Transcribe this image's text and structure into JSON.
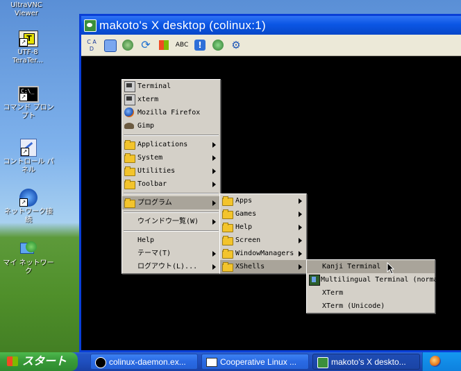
{
  "desktop": {
    "icons": [
      {
        "label": "UltraVNC Viewer",
        "icon": "ultravnc-icon"
      },
      {
        "label": "UTF-8 TeraTer...",
        "icon": "teraterm-icon"
      },
      {
        "label": "コマンド プロンプト",
        "icon": "command-prompt-icon"
      },
      {
        "label": "コントロール パネル",
        "icon": "control-panel-icon"
      },
      {
        "label": "ネットワーク接続",
        "icon": "network-connections-icon"
      },
      {
        "label": "マイ ネットワーク",
        "icon": "my-network-icon"
      }
    ]
  },
  "window": {
    "title": "makoto's X desktop (colinux:1)"
  },
  "toolbar": {
    "buttons": [
      "connection-options-icon",
      "fullscreen-icon",
      "refresh-icon",
      "swap-icon",
      "windows-key-icon",
      "text-chat-icon",
      "file-transfer-icon",
      "close-connection-icon",
      "options-icon"
    ],
    "glyphs": [
      "C A D",
      "",
      "",
      "",
      "",
      "ABC",
      "",
      "",
      ""
    ]
  },
  "root_menu": {
    "items": [
      {
        "label": "Terminal",
        "u": "T",
        "icon": "terminal-icon"
      },
      {
        "label": "xterm",
        "u": "x",
        "icon": "xterm-icon"
      },
      {
        "label": "Mozilla Firefox",
        "u": "M",
        "icon": "firefox-icon"
      },
      {
        "label": "Gimp",
        "u": "G",
        "icon": "gimp-icon"
      },
      {
        "label": "Applications",
        "u": "A",
        "icon": "folder-icon"
      },
      {
        "label": "System",
        "u": "S",
        "icon": "folder-icon"
      },
      {
        "label": "Utilities",
        "u": "U",
        "icon": "folder-icon"
      },
      {
        "label": "Toolbar",
        "u": "T",
        "icon": "folder-icon"
      },
      {
        "label": "プログラム",
        "icon": "folder-icon"
      },
      {
        "label": "ウインドウ一覧(W)",
        "icon": ""
      },
      {
        "label": "Help",
        "icon": ""
      },
      {
        "label": "テーマ(T)",
        "icon": ""
      },
      {
        "label": "ログアウト(L)...",
        "icon": ""
      }
    ]
  },
  "program_menu": {
    "items": [
      {
        "label": "Apps"
      },
      {
        "label": "Games"
      },
      {
        "label": "Help"
      },
      {
        "label": "Screen"
      },
      {
        "label": "WindowManagers"
      },
      {
        "label": "XShells"
      }
    ]
  },
  "xshells_menu": {
    "items": [
      {
        "label": "Kanji Terminal"
      },
      {
        "label": "Multilingual Terminal (normal)"
      },
      {
        "label": "XTerm"
      },
      {
        "label": "XTerm (Unicode)"
      }
    ]
  },
  "taskbar": {
    "start_label": "スタート",
    "tasks": [
      {
        "label": "colinux-daemon.ex...",
        "icon": "colinux-daemon-icon"
      },
      {
        "label": "Cooperative Linux ...",
        "icon": "cooperative-linux-icon"
      },
      {
        "label": "makoto's X deskto...",
        "icon": "vnc-viewer-icon"
      }
    ]
  }
}
